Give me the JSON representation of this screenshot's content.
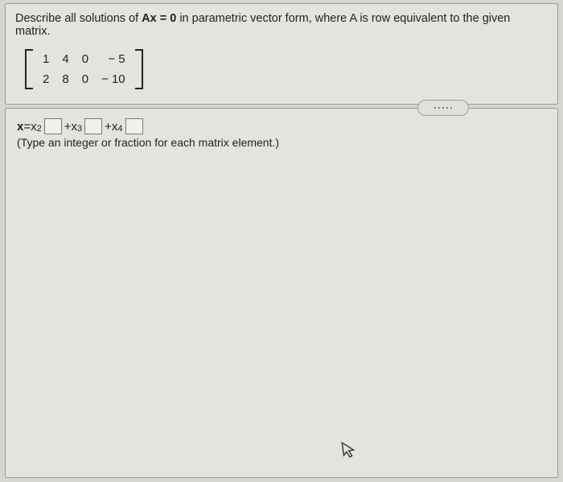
{
  "question": {
    "prompt_pre": "Describe all solutions of ",
    "prompt_eq": "Ax = 0",
    "prompt_post": " in parametric vector form, where A is row equivalent to the given matrix.",
    "matrix": [
      [
        "1",
        "4",
        "0",
        "− 5"
      ],
      [
        "2",
        "8",
        "0",
        "− 10"
      ]
    ]
  },
  "answer": {
    "lhs": "x",
    "eq": " = ",
    "term1_var": "x",
    "term1_sub": "2",
    "plus1": " + ",
    "term2_var": "x",
    "term2_sub": "3",
    "plus2": " + ",
    "term3_var": "x",
    "term3_sub": "4",
    "hint": "(Type an integer or fraction for each matrix element.)"
  }
}
